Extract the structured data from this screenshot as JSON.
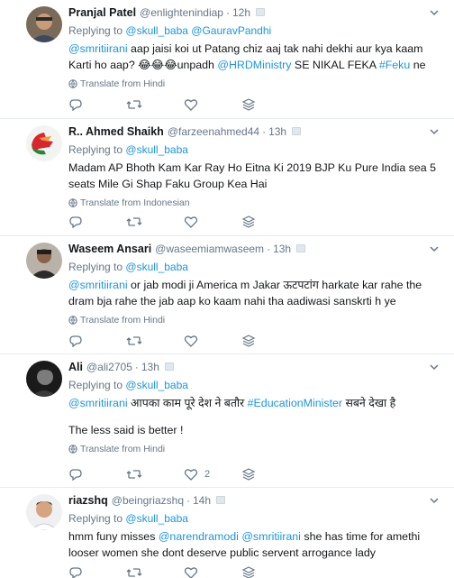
{
  "tweets": [
    {
      "name": "Pranjal Patel",
      "handle": "@enlightenindiap",
      "dot": "·",
      "time": "12h",
      "replying_prefix": "Replying to",
      "replying_to": "@skull_baba @GauravPandhi",
      "text_parts": [
        {
          "t": "@smritiirani",
          "link": true
        },
        {
          "t": "  aap jaisi koi ut Patang chiz aaj tak nahi dekhi aur kya kaam Karti ho aap? 😂😂😂unpadh ",
          "link": false
        },
        {
          "t": "@HRDMinistry",
          "link": true
        },
        {
          "t": " SE NIKAL FEKA ",
          "link": false
        },
        {
          "t": "#Feku",
          "link": true
        },
        {
          "t": " ne",
          "link": false
        }
      ],
      "translate": "Translate from Hindi",
      "retweet_count": "",
      "like_count": ""
    },
    {
      "name": "R.. Ahmed Shaikh",
      "handle": "@farzeenahmed44",
      "dot": "·",
      "time": "13h",
      "replying_prefix": "Replying to",
      "replying_to": "@skull_baba",
      "text_parts": [
        {
          "t": "Madam AP Bhoth Kam Kar Ray Ho Eitna Ki 2019 BJP Ku Pure India sea 5 seats Mile Gi Shap Faku Group Kea Hai",
          "link": false
        }
      ],
      "translate": "Translate from Indonesian",
      "retweet_count": "",
      "like_count": ""
    },
    {
      "name": "Waseem Ansari",
      "handle": "@waseemiamwaseem",
      "dot": "·",
      "time": "13h",
      "replying_prefix": "Replying to",
      "replying_to": "@skull_baba",
      "text_parts": [
        {
          "t": "@smritiirani",
          "link": true
        },
        {
          "t": " or jab modi ji America m Jakar ऊटपटांग harkate kar rahe the dram bja rahe the jab aap ko kaam nahi tha  aadiwasi sanskrti h ye",
          "link": false
        }
      ],
      "translate": "Translate from Hindi",
      "retweet_count": "",
      "like_count": ""
    },
    {
      "name": "Ali",
      "handle": "@ali2705",
      "dot": "·",
      "time": "13h",
      "replying_prefix": "Replying to",
      "replying_to": "@skull_baba",
      "text_parts": [
        {
          "t": "@smritiirani",
          "link": true
        },
        {
          "t": " आपका काम पूरे देश ने बतौर ",
          "link": false
        },
        {
          "t": "#EducationMinister",
          "link": true
        },
        {
          "t": " सबने देखा है",
          "link": false
        }
      ],
      "text2": "The less said is better !",
      "translate": "Translate from Hindi",
      "retweet_count": "",
      "like_count": "2"
    },
    {
      "name": "riazshq",
      "handle": "@beingriazshq",
      "dot": "·",
      "time": "14h",
      "replying_prefix": "Replying to",
      "replying_to": "@skull_baba",
      "text_parts": [
        {
          "t": "hmm funy misses ",
          "link": false
        },
        {
          "t": "@narendramodi",
          "link": true
        },
        {
          "t": " ",
          "link": false
        },
        {
          "t": "@smritiirani",
          "link": true
        },
        {
          "t": " she has time for amethi looser women she dont deserve public servent arrogance lady",
          "link": false
        }
      ],
      "translate": "",
      "retweet_count": "",
      "like_count": ""
    }
  ],
  "colors": {
    "link": "#1b95e0",
    "muted": "#657786",
    "divider": "#e6ecf0"
  }
}
